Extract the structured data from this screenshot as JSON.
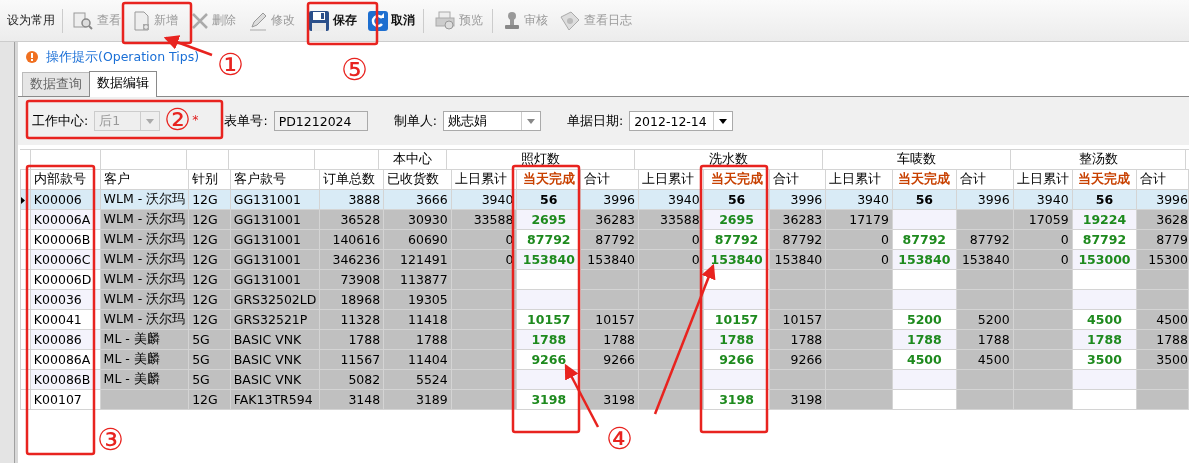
{
  "toolbar": [
    {
      "label": "设为常用",
      "disabled": false,
      "bold": false
    },
    {
      "label": "查看",
      "disabled": true,
      "bold": false
    },
    {
      "label": "新增",
      "disabled": true,
      "bold": false
    },
    {
      "label": "删除",
      "disabled": true,
      "bold": false
    },
    {
      "label": "修改",
      "disabled": true,
      "bold": false
    },
    {
      "label": "保存",
      "disabled": false,
      "bold": true
    },
    {
      "label": "取消",
      "disabled": false,
      "bold": true
    },
    {
      "label": "预览",
      "disabled": true,
      "bold": false
    },
    {
      "label": "审核",
      "disabled": true,
      "bold": false
    },
    {
      "label": "查看日志",
      "disabled": true,
      "bold": false
    }
  ],
  "tips": {
    "label": "操作提示(Operation Tips)"
  },
  "tabs": [
    {
      "label": "数据查询",
      "selected": false
    },
    {
      "label": "数据编辑",
      "selected": true
    }
  ],
  "form": [
    {
      "label": "工作中心:",
      "value": "后1",
      "kind": "combo",
      "disabled": true,
      "required": true,
      "required_mark": "*"
    },
    {
      "label": "表单号:",
      "value": "PD1212024",
      "kind": "text",
      "disabled": false,
      "required": false
    },
    {
      "label": "制单人:",
      "value": "姚志娟",
      "kind": "combo",
      "disabled": false,
      "required": false
    },
    {
      "label": "单据日期:",
      "value": "2012-12-14",
      "kind": "date",
      "disabled": false,
      "required": false
    }
  ],
  "table": {
    "columns": [
      {
        "label": "内部款号",
        "kind": "key"
      },
      {
        "label": "客户",
        "kind": "text"
      },
      {
        "label": "针别",
        "kind": "text"
      },
      {
        "label": "客户款号",
        "kind": "text"
      },
      {
        "label": "订单总数",
        "kind": "number"
      },
      {
        "label": "已收货数",
        "kind": "number",
        "group": "本中心"
      },
      {
        "label": "上日累计",
        "kind": "number",
        "group": "照灯数"
      },
      {
        "label": "当天完成",
        "kind": "entry"
      },
      {
        "label": "合计",
        "kind": "number"
      },
      {
        "label": "上日累计",
        "kind": "number",
        "group": "洗水数"
      },
      {
        "label": "当天完成",
        "kind": "entry"
      },
      {
        "label": "合计",
        "kind": "number"
      },
      {
        "label": "上日累计",
        "kind": "number",
        "group": "车唛数"
      },
      {
        "label": "当天完成",
        "kind": "entry"
      },
      {
        "label": "合计",
        "kind": "number"
      },
      {
        "label": "上日累计",
        "kind": "number",
        "group": "整汤数"
      },
      {
        "label": "当天完成",
        "kind": "entry"
      },
      {
        "label": "合计",
        "kind": "number"
      }
    ],
    "rows": [
      {
        "selected": true,
        "cells": [
          "K00006",
          "WLM - 沃尔玛",
          "12G",
          "GG131001",
          "3888",
          "3666",
          "3940",
          "56",
          "3996",
          "3940",
          "56",
          "3996",
          "3940",
          "56",
          "3996",
          "3940",
          "56",
          "3996"
        ]
      },
      {
        "selected": false,
        "cells": [
          "K00006A",
          "WLM - 沃尔玛",
          "12G",
          "GG131001",
          "36528",
          "30930",
          "33588",
          "2695",
          "36283",
          "33588",
          "2695",
          "36283",
          "17179",
          null,
          null,
          "17059",
          "19224",
          "3628"
        ]
      },
      {
        "selected": false,
        "cells": [
          "K00006B",
          "WLM - 沃尔玛",
          "12G",
          "GG131001",
          "140616",
          "60690",
          "0",
          "87792",
          "87792",
          "0",
          "87792",
          "87792",
          "0",
          "87792",
          "87792",
          "0",
          "87792",
          "8779"
        ]
      },
      {
        "selected": false,
        "cells": [
          "K00006C",
          "WLM - 沃尔玛",
          "12G",
          "GG131001",
          "346236",
          "121491",
          "0",
          "153840",
          "153840",
          "0",
          "153840",
          "153840",
          "0",
          "153840",
          "153840",
          "0",
          "153000",
          "15300"
        ]
      },
      {
        "selected": false,
        "cells": [
          "K00006D",
          "WLM - 沃尔玛",
          "12G",
          "GG131001",
          "73908",
          "113877",
          null,
          null,
          null,
          null,
          null,
          null,
          null,
          null,
          null,
          null,
          null,
          null
        ]
      },
      {
        "selected": false,
        "cells": [
          "K00036",
          "WLM - 沃尔玛",
          "12G",
          "GRS32502LD",
          "18968",
          "19305",
          null,
          null,
          null,
          null,
          null,
          null,
          null,
          null,
          null,
          null,
          null,
          null
        ]
      },
      {
        "selected": false,
        "cells": [
          "K00041",
          "WLM - 沃尔玛",
          "12G",
          "GRS32521P",
          "11328",
          "11418",
          null,
          "10157",
          "10157",
          null,
          "10157",
          "10157",
          null,
          "5200",
          "5200",
          null,
          "4500",
          "4500"
        ]
      },
      {
        "selected": false,
        "cells": [
          "K00086",
          "ML - 美麟",
          "5G",
          "BASIC VNK",
          "1788",
          "1788",
          null,
          "1788",
          "1788",
          null,
          "1788",
          "1788",
          null,
          "1788",
          "1788",
          null,
          "1788",
          "1788"
        ]
      },
      {
        "selected": false,
        "cells": [
          "K00086A",
          "ML - 美麟",
          "5G",
          "BASIC VNK",
          "11567",
          "11404",
          null,
          "9266",
          "9266",
          null,
          "9266",
          "9266",
          null,
          "4500",
          "4500",
          null,
          "3500",
          "3500"
        ]
      },
      {
        "selected": false,
        "cells": [
          "K00086B",
          "ML - 美麟",
          "5G",
          "BASIC VNK",
          "5082",
          "5524",
          null,
          null,
          null,
          null,
          null,
          null,
          null,
          null,
          null,
          null,
          null,
          null
        ]
      },
      {
        "selected": false,
        "cells": [
          "K00107",
          null,
          "12G",
          "FAK13TR594",
          "3148",
          "3189",
          null,
          "3198",
          "3198",
          null,
          "3198",
          "3198",
          null,
          null,
          null,
          null,
          null,
          null
        ]
      }
    ]
  },
  "annotations": [
    {
      "label": "①"
    },
    {
      "label": "②"
    },
    {
      "label": "③"
    },
    {
      "label": "④"
    },
    {
      "label": "⑤"
    }
  ]
}
